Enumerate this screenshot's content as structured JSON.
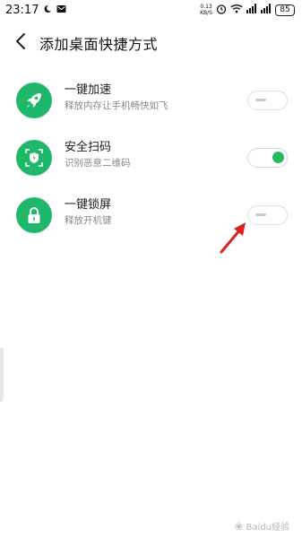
{
  "status_bar": {
    "time": "23:17",
    "net_speed_value": "0.13",
    "net_speed_unit": "KB/S",
    "battery": "85"
  },
  "header": {
    "title": "添加桌面快捷方式"
  },
  "shortcuts": [
    {
      "title": "一键加速",
      "subtitle": "释放内存让手机畅快如飞",
      "enabled": false,
      "icon": "rocket-icon"
    },
    {
      "title": "安全扫码",
      "subtitle": "识别恶意二维码",
      "enabled": true,
      "icon": "shield-scan-icon"
    },
    {
      "title": "一键锁屏",
      "subtitle": "释放开机键",
      "enabled": false,
      "icon": "lock-icon"
    }
  ],
  "colors": {
    "accent_green": "#1fb86b",
    "toggle_on": "#23b95f",
    "arrow_red": "#e02020"
  },
  "watermark": "Baidu经验"
}
